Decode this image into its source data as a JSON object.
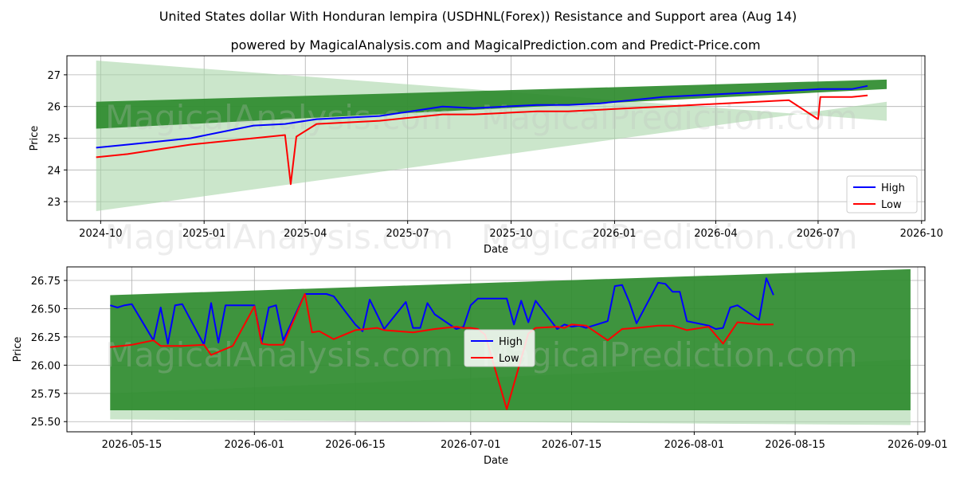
{
  "title_line1": "United States dollar With Honduran lempira (USDHNL(Forex)) Resistance and Support area (Aug 14)",
  "title_line2": "powered by MagicalAnalysis.com and MagicalPrediction.com and Predict-Price.com",
  "watermark_left": "MagicalAnalysis.com",
  "watermark_right": "MagicalPrediction.com",
  "colors": {
    "high": "#0000ff",
    "low": "#ff0000",
    "band_dark": "#2e8b2e",
    "band_light": "#a8d5a8"
  },
  "chart_data": [
    {
      "type": "line",
      "xlabel": "Date",
      "ylabel": "Price",
      "xlim": [
        "2024-09-01",
        "2026-10-04"
      ],
      "ylim": [
        22.4,
        27.6
      ],
      "grid": true,
      "legend_position": "center-right",
      "xticks": [
        "2024-10",
        "2025-01",
        "2025-04",
        "2025-07",
        "2025-10",
        "2026-01",
        "2026-04",
        "2026-07",
        "2026-10"
      ],
      "yticks": [
        23,
        24,
        25,
        26,
        27
      ],
      "bands": [
        {
          "x": [
            "2024-09-27",
            "2026-08-31"
          ],
          "upper": [
            27.45,
            25.55
          ],
          "lower": [
            22.7,
            26.15
          ],
          "shade": "light"
        },
        {
          "x": [
            "2024-09-27",
            "2026-08-31"
          ],
          "upper": [
            26.15,
            26.85
          ],
          "lower": [
            25.3,
            26.55
          ],
          "shade": "dark"
        }
      ],
      "series": [
        {
          "name": "High",
          "x": [
            "2024-09-27",
            "2024-10-25",
            "2024-11-22",
            "2024-12-20",
            "2025-01-17",
            "2025-02-14",
            "2025-03-14",
            "2025-04-11",
            "2025-05-09",
            "2025-06-06",
            "2025-07-04",
            "2025-08-01",
            "2025-08-29",
            "2025-09-26",
            "2025-10-24",
            "2025-11-21",
            "2025-12-19",
            "2026-01-16",
            "2026-02-13",
            "2026-03-13",
            "2026-04-10",
            "2026-05-08",
            "2026-06-05",
            "2026-07-03",
            "2026-07-31",
            "2026-08-14"
          ],
          "y": [
            24.7,
            24.8,
            24.9,
            25.0,
            25.2,
            25.4,
            25.45,
            25.6,
            25.65,
            25.7,
            25.85,
            26.0,
            25.95,
            26.0,
            26.05,
            26.05,
            26.1,
            26.2,
            26.3,
            26.35,
            26.4,
            26.45,
            26.5,
            26.55,
            26.55,
            26.65
          ]
        },
        {
          "name": "Low",
          "x": [
            "2024-09-27",
            "2024-10-25",
            "2024-11-22",
            "2024-12-20",
            "2025-01-17",
            "2025-02-14",
            "2025-03-14",
            "2025-03-19",
            "2025-03-24",
            "2025-04-11",
            "2025-05-09",
            "2025-06-06",
            "2025-07-04",
            "2025-08-01",
            "2025-08-29",
            "2025-09-26",
            "2025-10-24",
            "2025-11-21",
            "2025-12-19",
            "2026-01-16",
            "2026-02-13",
            "2026-03-13",
            "2026-04-10",
            "2026-05-08",
            "2026-06-05",
            "2026-07-01",
            "2026-07-03",
            "2026-07-31",
            "2026-08-14"
          ],
          "y": [
            24.4,
            24.5,
            24.65,
            24.8,
            24.9,
            25.0,
            25.1,
            23.55,
            25.05,
            25.45,
            25.5,
            25.55,
            25.65,
            25.75,
            25.75,
            25.8,
            25.85,
            25.85,
            25.9,
            25.95,
            26.0,
            26.05,
            26.1,
            26.15,
            26.2,
            25.6,
            26.3,
            26.3,
            26.35
          ]
        }
      ]
    },
    {
      "type": "line",
      "xlabel": "Date",
      "ylabel": "Price",
      "xlim": [
        "2026-05-06",
        "2026-09-02"
      ],
      "ylim": [
        25.41,
        26.87
      ],
      "grid": true,
      "legend_position": "center",
      "xticks": [
        "2026-05-15",
        "2026-06-01",
        "2026-06-15",
        "2026-07-01",
        "2026-07-15",
        "2026-08-01",
        "2026-08-15",
        "2026-09-01"
      ],
      "yticks": [
        "25.50",
        "25.75",
        "26.00",
        "26.25",
        "26.50",
        "26.75"
      ],
      "bands": [
        {
          "x": [
            "2026-05-12",
            "2026-08-31"
          ],
          "upper": [
            25.75,
            26.05
          ],
          "lower": [
            25.52,
            25.47
          ],
          "shade": "light"
        },
        {
          "x": [
            "2026-05-12",
            "2026-08-31"
          ],
          "upper": [
            26.62,
            26.85
          ],
          "lower": [
            25.6,
            25.6
          ],
          "shade": "dark"
        }
      ],
      "series": [
        {
          "name": "High",
          "x": [
            "2026-05-12",
            "2026-05-13",
            "2026-05-14",
            "2026-05-15",
            "2026-05-18",
            "2026-05-19",
            "2026-05-20",
            "2026-05-21",
            "2026-05-22",
            "2026-05-25",
            "2026-05-26",
            "2026-05-27",
            "2026-05-28",
            "2026-05-29",
            "2026-06-01",
            "2026-06-02",
            "2026-06-03",
            "2026-06-04",
            "2026-06-05",
            "2026-06-08",
            "2026-06-09",
            "2026-06-10",
            "2026-06-11",
            "2026-06-12",
            "2026-06-15",
            "2026-06-16",
            "2026-06-17",
            "2026-06-18",
            "2026-06-19",
            "2026-06-22",
            "2026-06-23",
            "2026-06-24",
            "2026-06-25",
            "2026-06-26",
            "2026-06-29",
            "2026-06-30",
            "2026-07-01",
            "2026-07-02",
            "2026-07-03",
            "2026-07-06",
            "2026-07-07",
            "2026-07-08",
            "2026-07-09",
            "2026-07-10",
            "2026-07-13",
            "2026-07-14",
            "2026-07-15",
            "2026-07-16",
            "2026-07-17",
            "2026-07-20",
            "2026-07-21",
            "2026-07-22",
            "2026-07-23",
            "2026-07-24",
            "2026-07-27",
            "2026-07-28",
            "2026-07-29",
            "2026-07-30",
            "2026-07-31",
            "2026-08-03",
            "2026-08-04",
            "2026-08-05",
            "2026-08-06",
            "2026-08-07",
            "2026-08-10",
            "2026-08-11",
            "2026-08-12"
          ],
          "y": [
            26.53,
            26.51,
            26.53,
            26.54,
            26.22,
            26.51,
            26.19,
            26.53,
            26.54,
            26.18,
            26.55,
            26.2,
            26.53,
            26.53,
            26.53,
            26.2,
            26.51,
            26.53,
            26.22,
            26.63,
            26.63,
            26.63,
            26.63,
            26.61,
            26.36,
            26.3,
            26.58,
            26.45,
            26.32,
            26.56,
            26.33,
            26.33,
            26.55,
            26.45,
            26.32,
            26.34,
            26.53,
            26.59,
            26.59,
            26.59,
            26.36,
            26.57,
            26.38,
            26.57,
            26.32,
            26.36,
            26.34,
            26.35,
            26.33,
            26.39,
            26.7,
            26.71,
            26.56,
            26.37,
            26.73,
            26.72,
            26.65,
            26.65,
            26.39,
            26.35,
            26.32,
            26.33,
            26.51,
            26.53,
            26.4,
            26.77,
            26.62
          ]
        },
        {
          "name": "Low",
          "x": [
            "2026-05-12",
            "2026-05-15",
            "2026-05-18",
            "2026-05-19",
            "2026-05-22",
            "2026-05-25",
            "2026-05-26",
            "2026-05-29",
            "2026-06-01",
            "2026-06-02",
            "2026-06-03",
            "2026-06-05",
            "2026-06-08",
            "2026-06-09",
            "2026-06-10",
            "2026-06-12",
            "2026-06-15",
            "2026-06-18",
            "2026-06-19",
            "2026-06-23",
            "2026-06-26",
            "2026-06-29",
            "2026-06-30",
            "2026-07-01",
            "2026-07-02",
            "2026-07-03",
            "2026-07-06",
            "2026-07-09",
            "2026-07-10",
            "2026-07-13",
            "2026-07-14",
            "2026-07-15",
            "2026-07-17",
            "2026-07-20",
            "2026-07-22",
            "2026-07-24",
            "2026-07-27",
            "2026-07-29",
            "2026-07-31",
            "2026-08-03",
            "2026-08-05",
            "2026-08-07",
            "2026-08-10",
            "2026-08-12"
          ],
          "y": [
            26.16,
            26.18,
            26.22,
            26.17,
            26.17,
            26.18,
            26.09,
            26.17,
            26.52,
            26.19,
            26.18,
            26.18,
            26.63,
            26.29,
            26.3,
            26.23,
            26.31,
            26.33,
            26.31,
            26.29,
            26.32,
            26.34,
            26.33,
            26.33,
            26.32,
            26.27,
            25.61,
            26.28,
            26.33,
            26.34,
            26.33,
            26.36,
            26.35,
            26.22,
            26.32,
            26.33,
            26.35,
            26.35,
            26.31,
            26.34,
            26.19,
            26.38,
            26.36,
            26.36
          ]
        }
      ]
    }
  ]
}
